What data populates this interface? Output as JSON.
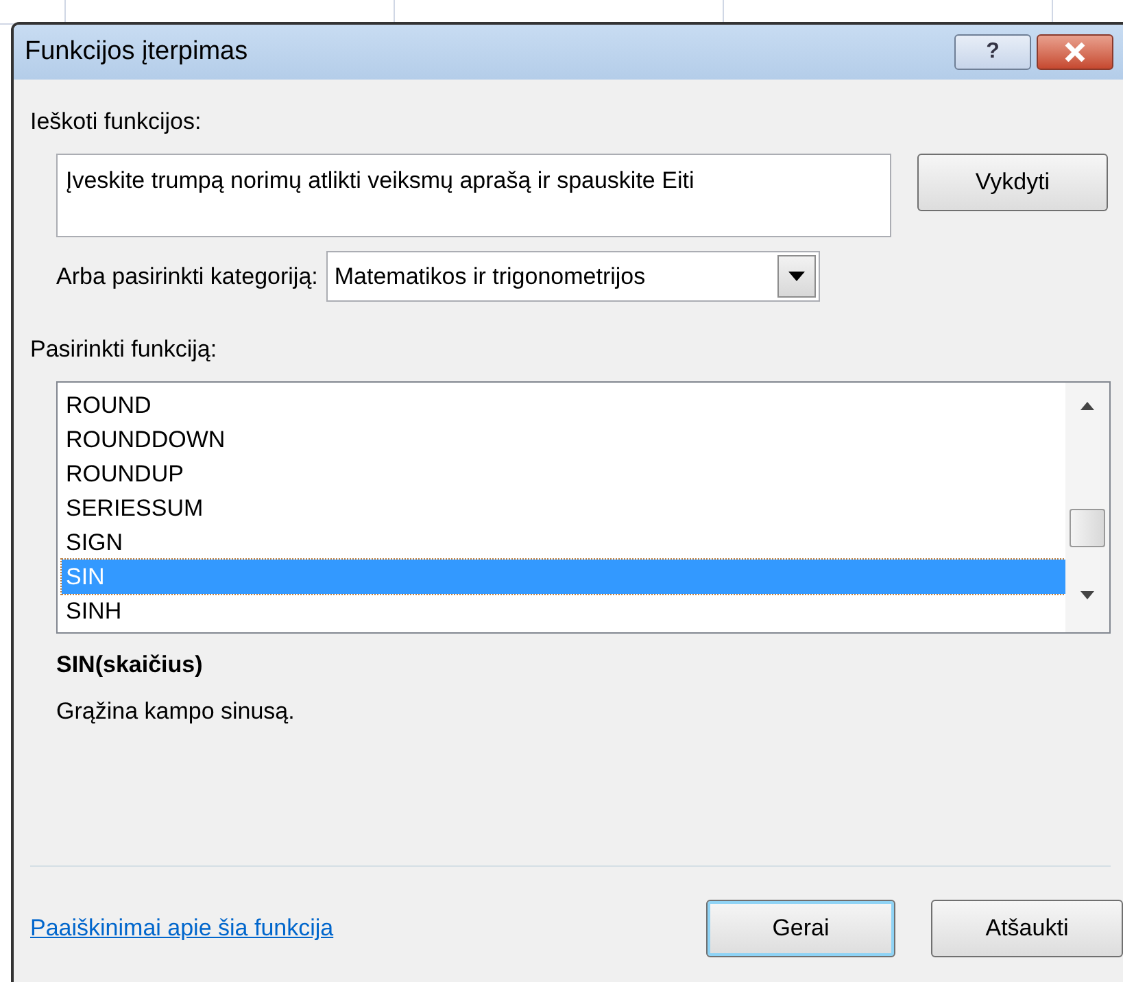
{
  "window": {
    "title": "Funkcijos įterpimas",
    "help_button": "?"
  },
  "search": {
    "label": "Ieškoti funkcijos:",
    "value": "Įveskite trumpą norimų atlikti veiksmų aprašą ir spauskite Eiti",
    "button": "Vykdyti"
  },
  "category": {
    "label": "Arba pasirinkti kategoriją:",
    "value": "Matematikos ir trigonometrijos"
  },
  "functions": {
    "label": "Pasirinkti funkciją:",
    "items": [
      {
        "name": "ROUND",
        "selected": false
      },
      {
        "name": "ROUNDDOWN",
        "selected": false
      },
      {
        "name": "ROUNDUP",
        "selected": false
      },
      {
        "name": "SERIESSUM",
        "selected": false
      },
      {
        "name": "SIGN",
        "selected": false
      },
      {
        "name": "SIN",
        "selected": true
      },
      {
        "name": "SINH",
        "selected": false
      }
    ]
  },
  "signature": "SIN(skaičius)",
  "description": "Grąžina kampo sinusą.",
  "help_link": "Paaiškinimai apie šia funkcija",
  "buttons": [
    {
      "label": "Gerai",
      "kind": "default"
    },
    {
      "label": "Atšaukti",
      "kind": "normal"
    }
  ]
}
